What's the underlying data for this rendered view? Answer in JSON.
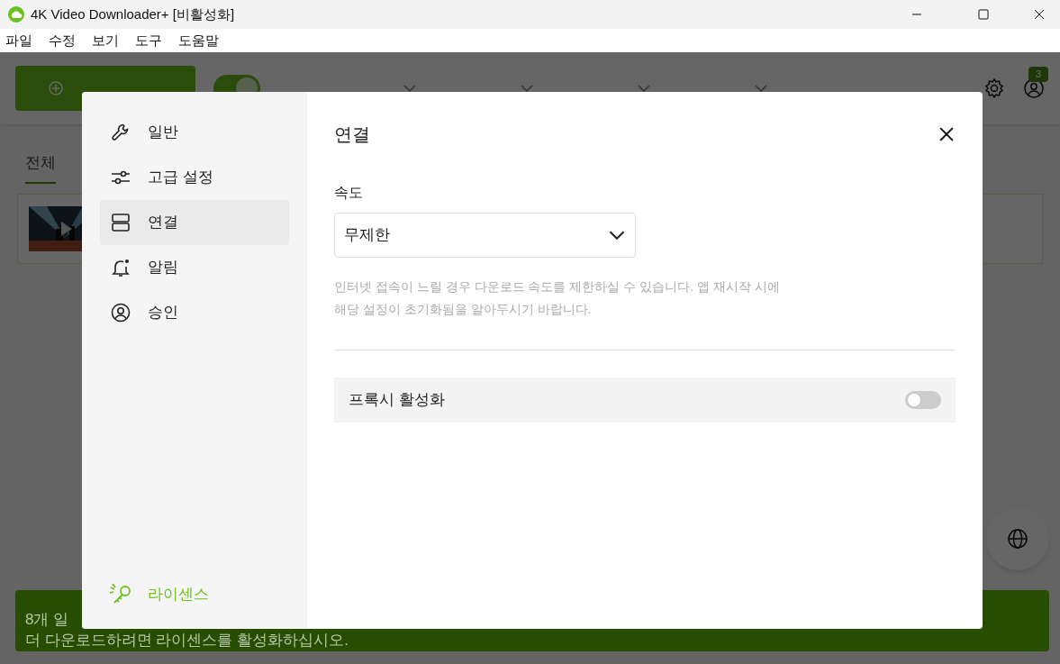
{
  "window": {
    "title": "4K Video Downloader+ [비활성화]"
  },
  "menu": [
    "파일",
    "수정",
    "보기",
    "도구",
    "도움말"
  ],
  "toolbar": {
    "smart_mode_on": true,
    "account_badge": "3"
  },
  "tabs": [
    {
      "label": "전체",
      "selected": true
    }
  ],
  "banner": {
    "line_1": "8개 일",
    "line_2": "더 다운로드하려면 라이센스를 활성화하십시오."
  },
  "dialog": {
    "sidebar": [
      {
        "label": "일반",
        "kind": "wrench",
        "selected": false
      },
      {
        "label": "고급 설정",
        "kind": "sliders",
        "selected": false
      },
      {
        "label": "연결",
        "kind": "server",
        "selected": true
      },
      {
        "label": "알림",
        "kind": "bell",
        "selected": false
      },
      {
        "label": "승인",
        "kind": "user",
        "selected": false
      }
    ],
    "license_link": "라이센스",
    "title": "연결",
    "speed": {
      "label": "속도",
      "value": "무제한",
      "hint": "인터넷 접속이 느릴 경우 다운로드 속도를 제한하실 수 있습니다. 앱 재시작 시에 해당 설정이 초기화됨을 알아두시기 바랍니다."
    },
    "proxy": {
      "label": "프록시 활성화",
      "on": false
    }
  }
}
